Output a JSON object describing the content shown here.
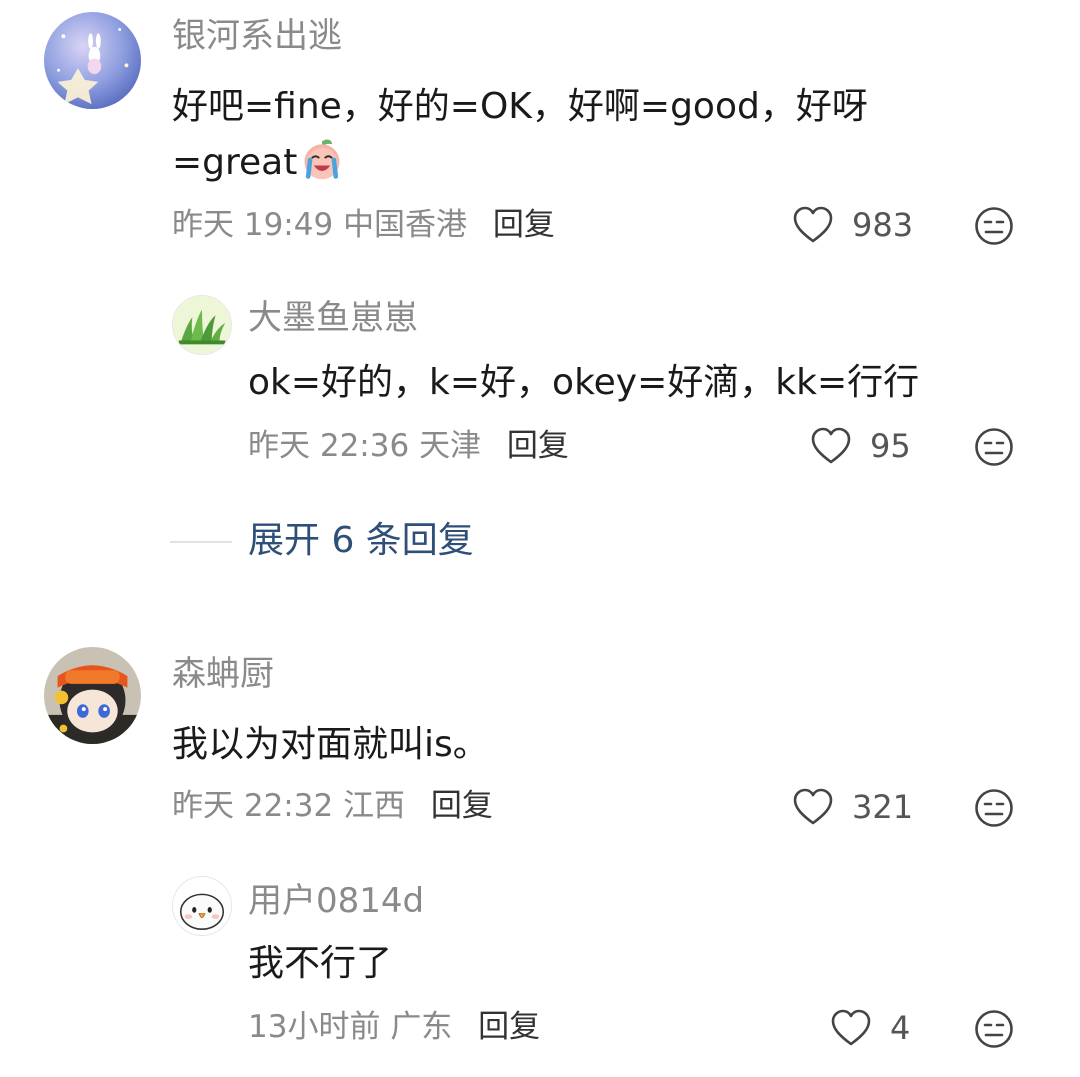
{
  "comments": [
    {
      "avatar": "starry-bunny-avatar",
      "username": "银河系出逃",
      "content_line1": "好吧=fine，好的=OK，好啊=good，好呀",
      "content_line2": "=great",
      "emoji": "laughing-crying-peach-emoji",
      "time": "昨天 19:49",
      "location": "中国香港",
      "reply_label": "回复",
      "likes": "983",
      "replies": [
        {
          "avatar": "green-grass-avatar",
          "username": "大墨鱼崽崽",
          "content": "ok=好的，k=好，okey=好滴，kk=行行",
          "time": "昨天 22:36",
          "location": "天津",
          "reply_label": "回复",
          "likes": "95"
        }
      ],
      "expand_label": "展开 6 条回复"
    },
    {
      "avatar": "cartoon-character-avatar",
      "username": "森蚺厨",
      "content": "我以为对面就叫is。",
      "time": "昨天 22:32",
      "location": "江西",
      "reply_label": "回复",
      "likes": "321",
      "replies": [
        {
          "avatar": "white-bird-avatar",
          "username": "用户0814d",
          "content": "我不行了",
          "time": "13小时前",
          "location": "广东",
          "reply_label": "回复",
          "likes": "4"
        }
      ]
    }
  ],
  "icons": {
    "like": "heart-outline-icon",
    "dislike": "meh-face-icon"
  },
  "colors": {
    "username": "#8a8a8a",
    "content": "#1a1a1a",
    "meta": "#8a8a8a",
    "reply": "#333333",
    "expand": "#2e4f78",
    "icon": "#444444"
  }
}
